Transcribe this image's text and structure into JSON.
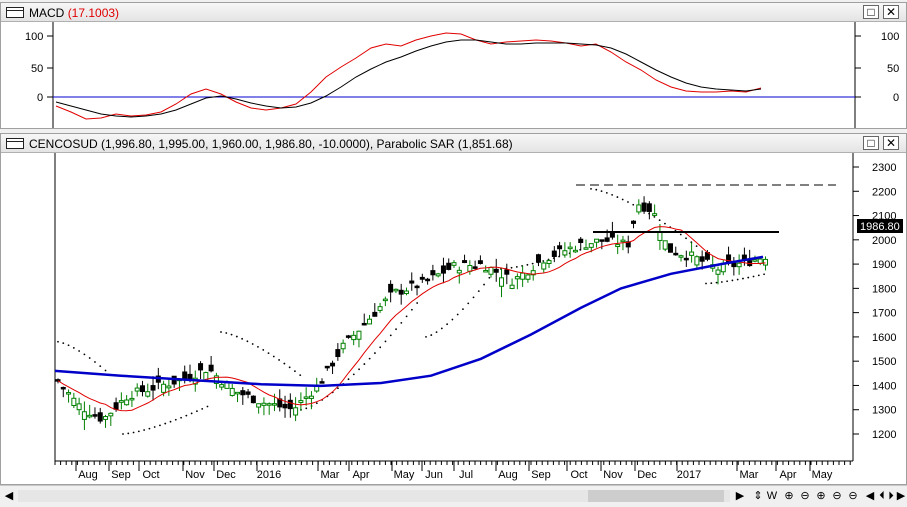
{
  "macd_window": {
    "title": "MACD",
    "value": "(17.1003)",
    "ticks": [
      "100",
      "50",
      "0"
    ],
    "colors": {
      "macd": "#000000",
      "signal": "#e00000",
      "zero": "#0000d0"
    }
  },
  "price_window": {
    "title": "CENCOSUD (1,996.80, 1,995.00, 1,960.00, 1,986.80, -10.0000), Parabolic SAR (1,851.68)",
    "last_price": "1986.80",
    "y_ticks": [
      "2300",
      "2200",
      "2100",
      "2000",
      "1900",
      "1800",
      "1700",
      "1600",
      "1500",
      "1400",
      "1300",
      "1200"
    ],
    "colors": {
      "up": "#008000",
      "down": "#000000",
      "fast_ma": "#e00000",
      "slow_ma": "#0000c8"
    }
  },
  "x_axis": {
    "labels": [
      "Aug",
      "Sep",
      "Oct",
      "Nov",
      "Dec",
      "2016",
      "Mar",
      "Apr",
      "May",
      "Jun",
      "Jul",
      "Aug",
      "Sep",
      "Oct",
      "Nov",
      "Dec",
      "2017",
      "Mar",
      "Apr",
      "May"
    ]
  },
  "window_buttons": {
    "maximize": "□",
    "close": "✕"
  },
  "scrollbar": {
    "left_arrow": "◀",
    "right_arrow": "▶"
  },
  "nav": {
    "reset": "⇕",
    "weekly": "W",
    "zoom_in": "⊕",
    "zoom_out": "⊖",
    "first": "⏴",
    "prev": "◀",
    "next": "▶",
    "last": "⏵"
  },
  "chart_data": {
    "type": "line",
    "title": "CENCOSUD",
    "y_range": [
      1150,
      2330
    ],
    "x": [
      "Aug",
      "Sep",
      "Oct",
      "Nov",
      "Dec",
      "2016",
      "Mar",
      "Apr",
      "May",
      "Jun",
      "Jul",
      "Aug",
      "Sep",
      "Oct",
      "Nov",
      "Dec",
      "2017",
      "Mar"
    ],
    "series": [
      {
        "name": "CENCOSUD",
        "values": [
          1330,
          1360,
          1390,
          1470,
          1360,
          1320,
          1460,
          1620,
          1780,
          1890,
          1880,
          1940,
          1980,
          2160,
          1920,
          1870,
          1950,
          1987
        ]
      },
      {
        "name": "MACD",
        "values": [
          -20,
          -30,
          -20,
          5,
          -5,
          -10,
          40,
          70,
          85,
          95,
          90,
          88,
          90,
          70,
          35,
          15,
          12,
          17
        ]
      }
    ]
  }
}
